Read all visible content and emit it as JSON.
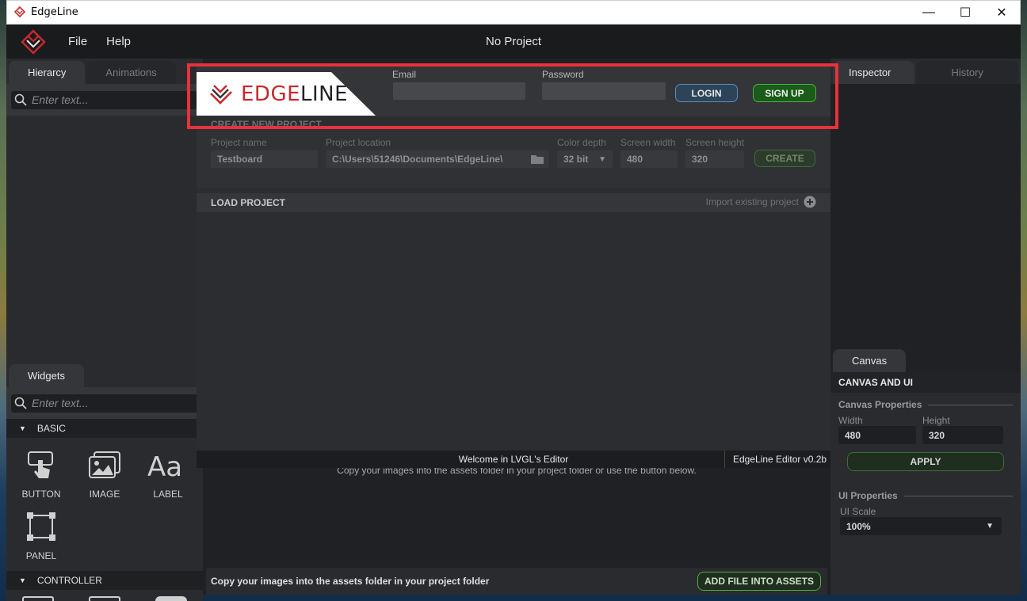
{
  "window": {
    "title": "EdgeLine",
    "minimize": "—",
    "maximize": "☐",
    "close": "✕"
  },
  "menubar": {
    "file": "File",
    "help": "Help",
    "project_name": "No Project"
  },
  "left": {
    "tabs": [
      "Hierarcy",
      "Animations"
    ],
    "search_placeholder": "Enter text...",
    "widgets_tab": "Widgets",
    "widgets_search_placeholder": "Enter text...",
    "categories": [
      {
        "name": "BASIC",
        "items": [
          "BUTTON",
          "IMAGE",
          "LABEL",
          "PANEL"
        ]
      },
      {
        "name": "CONTROLLER",
        "items": []
      }
    ]
  },
  "right": {
    "tabs": [
      "Inspector",
      "History"
    ],
    "canvas_tab": "Canvas",
    "canvas_header": "CANVAS AND UI",
    "canvas_props": "Canvas Properties",
    "width_label": "Width",
    "height_label": "Height",
    "width_value": "480",
    "height_value": "320",
    "apply": "APPLY",
    "ui_props": "UI Properties",
    "ui_scale_label": "UI Scale",
    "ui_scale_value": "100%"
  },
  "assets": {
    "hint": "Copy your images into the assets folder in your project folder or use the button below.",
    "footer_text": "Copy your images into the assets folder in your project folder",
    "add_button": "ADD FILE INTO ASSETS"
  },
  "modal": {
    "brand_edge": "EDGE",
    "brand_line": "LINE",
    "email_label": "Email",
    "password_label": "Password",
    "login": "LOGIN",
    "signup": "SIGN UP",
    "create_title": "CREATE NEW PROJECT",
    "project_name_label": "Project name",
    "project_name_value": "Testboard",
    "project_location_label": "Project location",
    "project_location_value": "C:\\Users\\51246\\Documents\\EdgeLine\\",
    "color_depth_label": "Color depth",
    "color_depth_value": "32 bit",
    "screen_width_label": "Screen width",
    "screen_width_value": "480",
    "screen_height_label": "Screen height",
    "screen_height_value": "320",
    "create": "CREATE",
    "load_title": "LOAD PROJECT",
    "import_link": "Import existing project",
    "welcome": "Welcome in LVGL's Editor",
    "version": "EdgeLine Editor v0.2b"
  },
  "colors": {
    "accent_red": "#c7292d",
    "highlight": "#e8313a",
    "signup_green": "#1a5a1a",
    "login_blue": "#2d4358"
  }
}
